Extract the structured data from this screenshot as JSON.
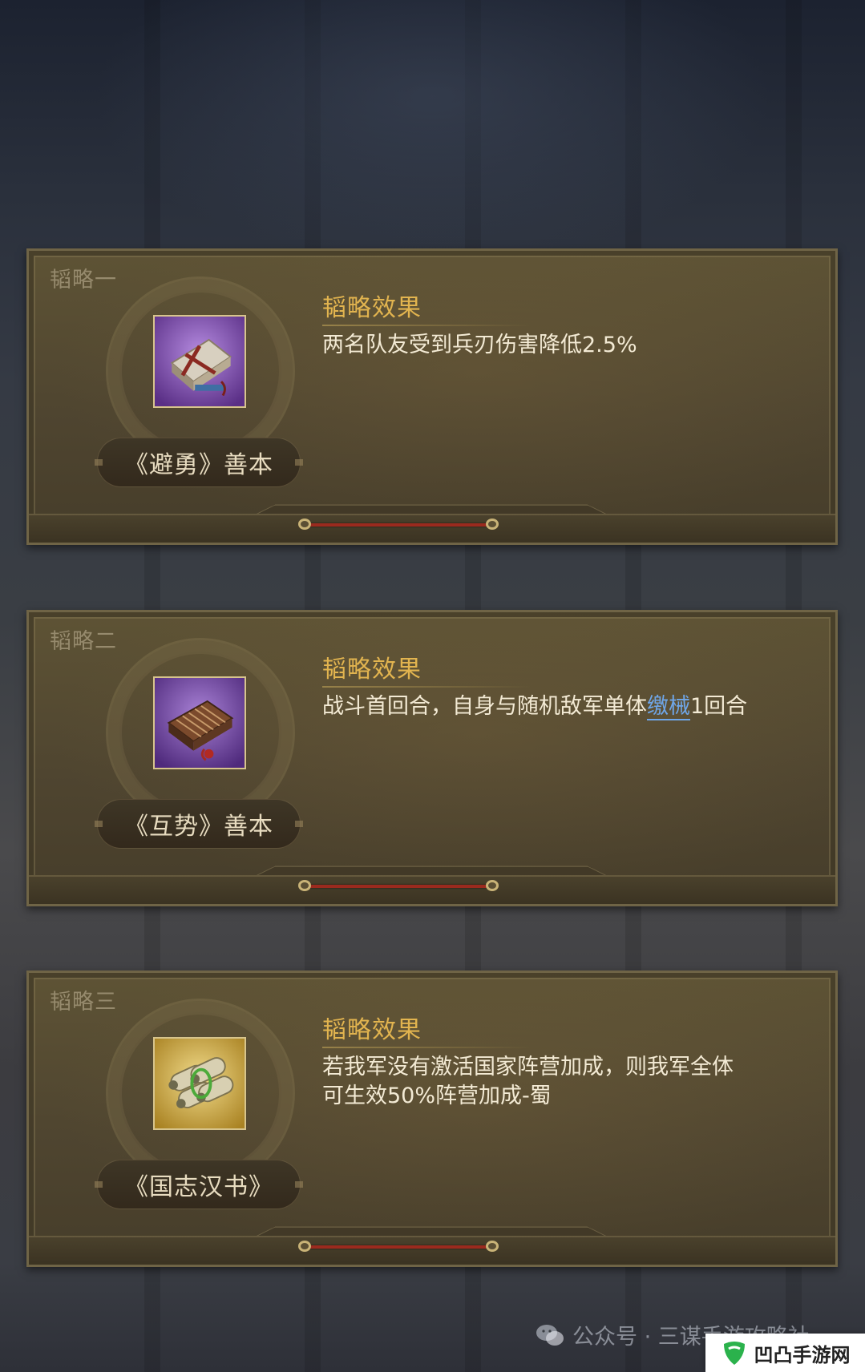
{
  "cards": [
    {
      "label": "韬略一",
      "item_name": "《避勇》善本",
      "item_icon": "book-bundle-icon",
      "item_bg": "#7a4aa8",
      "effect_title": "韬略效果",
      "effect_text": "两名队友受到兵刃伤害降低2.5%"
    },
    {
      "label": "韬略二",
      "item_name": "《互势》善本",
      "item_icon": "bamboo-book-icon",
      "item_bg": "#6d3f98",
      "effect_title": "韬略效果",
      "effect_text_before": "战斗首回合，自身与随机敌军单体",
      "effect_link": "缴械",
      "effect_text_after": "1回合"
    },
    {
      "label": "韬略三",
      "item_name": "《国志汉书》",
      "item_icon": "scroll-bundle-icon",
      "item_bg": "#c9a43f",
      "effect_title": "韬略效果",
      "effect_line1": "若我军没有激活国家阵营加成，则我军全体",
      "effect_line2": "可生效50%阵营加成-蜀"
    }
  ],
  "watermark": {
    "text": "公众号 · 三谋手游攻略社",
    "icon": "wechat-icon"
  },
  "site_badge": {
    "name": "凹凸手游网",
    "icon": "site-logo-icon",
    "accent": "#2bb24c"
  }
}
